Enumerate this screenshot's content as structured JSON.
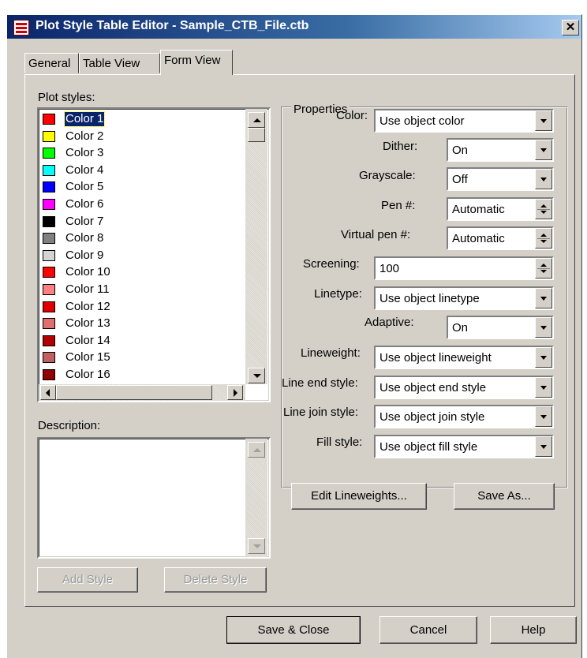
{
  "window": {
    "title": "Plot Style Table Editor - Sample_CTB_File.ctb",
    "close": "✕"
  },
  "tabs": [
    "General",
    "Table View",
    "Form View"
  ],
  "plot_styles": {
    "label": "Plot styles:",
    "items": [
      {
        "name": "Color 1",
        "color": "#ff0000",
        "selected": true
      },
      {
        "name": "Color 2",
        "color": "#ffff00"
      },
      {
        "name": "Color 3",
        "color": "#00ff00"
      },
      {
        "name": "Color 4",
        "color": "#00ffff"
      },
      {
        "name": "Color 5",
        "color": "#0000ff"
      },
      {
        "name": "Color 6",
        "color": "#ff00ff"
      },
      {
        "name": "Color 7",
        "color": "#000000"
      },
      {
        "name": "Color 8",
        "color": "#808080"
      },
      {
        "name": "Color 9",
        "color": "#d4d4d4"
      },
      {
        "name": "Color 10",
        "color": "#ff0000"
      },
      {
        "name": "Color 11",
        "color": "#ff8080"
      },
      {
        "name": "Color 12",
        "color": "#dd0000"
      },
      {
        "name": "Color 13",
        "color": "#e07070"
      },
      {
        "name": "Color 14",
        "color": "#b00000"
      },
      {
        "name": "Color 15",
        "color": "#c06060"
      },
      {
        "name": "Color 16",
        "color": "#900000"
      }
    ]
  },
  "description": {
    "label": "Description:",
    "value": ""
  },
  "buttons": {
    "add_style": "Add Style",
    "delete_style": "Delete Style",
    "edit_lineweights": "Edit Lineweights...",
    "save_as": "Save As...",
    "save_close": "Save & Close",
    "cancel": "Cancel",
    "help": "Help"
  },
  "properties": {
    "legend": "Properties",
    "color": {
      "label": "Color:",
      "value": "Use object color"
    },
    "dither": {
      "label": "Dither:",
      "value": "On"
    },
    "grayscale": {
      "label": "Grayscale:",
      "value": "Off"
    },
    "pen": {
      "label": "Pen #:",
      "value": "Automatic"
    },
    "virtual_pen": {
      "label": "Virtual pen #:",
      "value": "Automatic"
    },
    "screening": {
      "label": "Screening:",
      "value": "100"
    },
    "linetype": {
      "label": "Linetype:",
      "value": "Use object linetype"
    },
    "adaptive": {
      "label": "Adaptive:",
      "value": "On"
    },
    "lineweight": {
      "label": "Lineweight:",
      "value": "Use object lineweight"
    },
    "line_end": {
      "label": "Line end style:",
      "value": "Use object end style"
    },
    "line_join": {
      "label": "Line join style:",
      "value": "Use object join style"
    },
    "fill": {
      "label": "Fill style:",
      "value": "Use object fill style"
    }
  }
}
